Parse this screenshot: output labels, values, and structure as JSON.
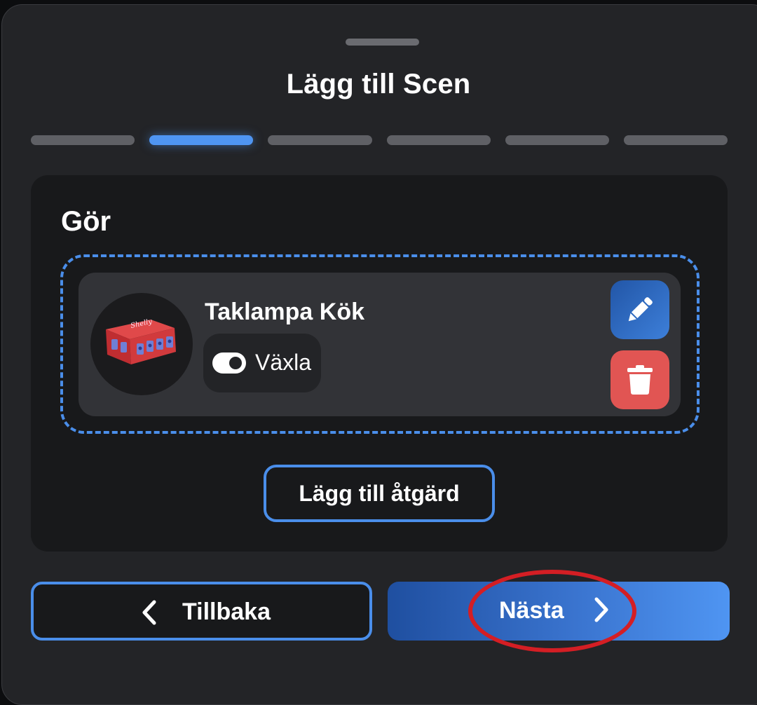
{
  "dialog": {
    "title": "Lägg till Scen",
    "steps": {
      "total": 6,
      "active_index": 1
    }
  },
  "section": {
    "heading": "Gör"
  },
  "action_item": {
    "device_name": "Taklampa Kök",
    "action_label": "Växla",
    "action_icon": "toggle-icon",
    "edit_icon": "pencil-icon",
    "delete_icon": "trash-icon"
  },
  "buttons": {
    "add_action": "Lägg till åtgärd",
    "back": "Tillbaka",
    "next": "Nästa"
  },
  "colors": {
    "accent": "#4a8eea",
    "delete": "#e15553",
    "highlight_circle": "#d41e24"
  }
}
